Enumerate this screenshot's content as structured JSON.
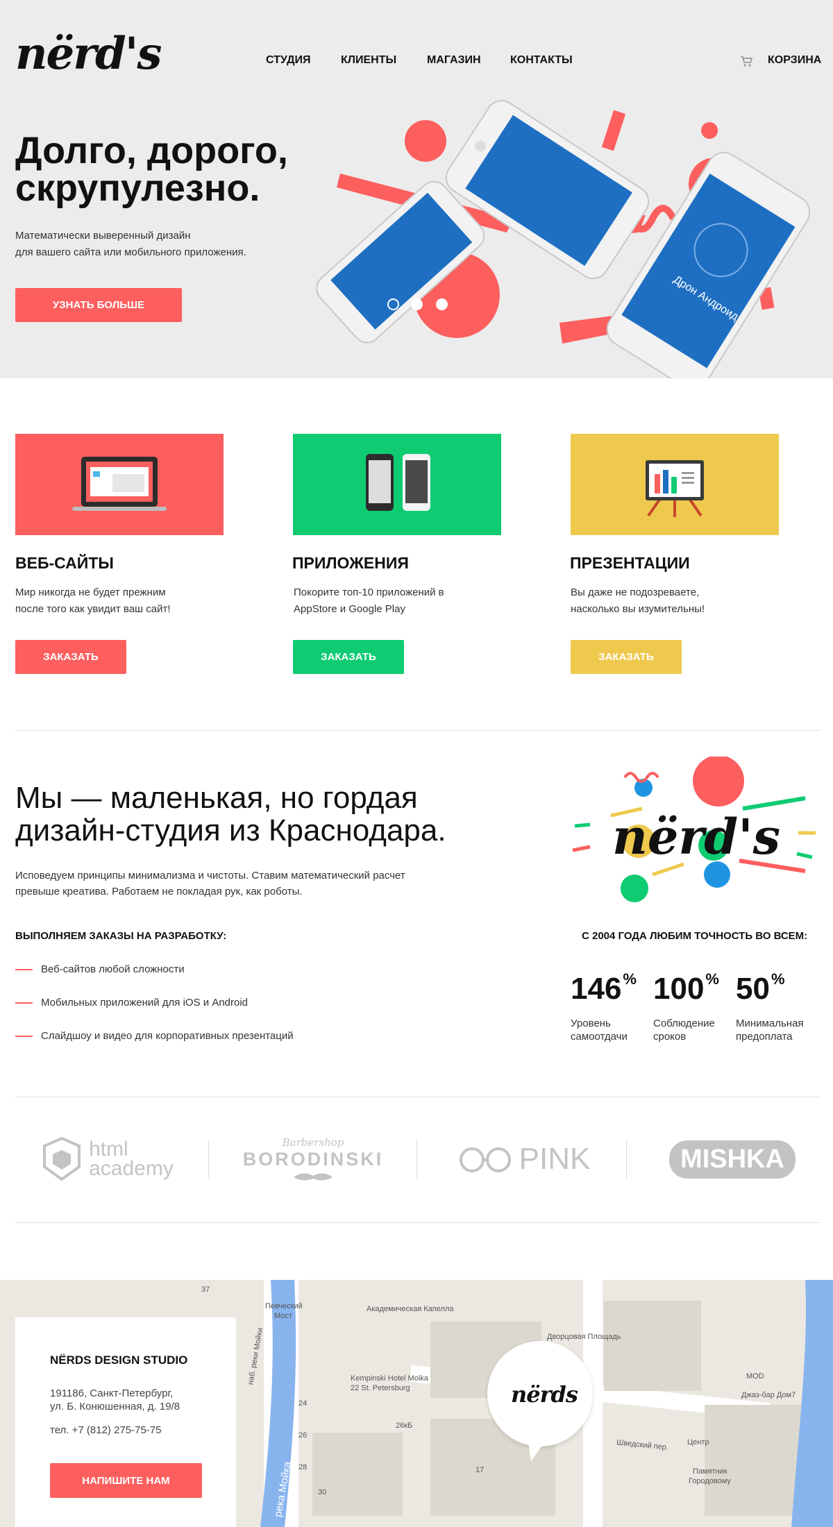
{
  "header": {
    "logo": "nërd's",
    "nav": [
      "СТУДИЯ",
      "КЛИЕНТЫ",
      "МАГАЗИН",
      "КОНТАКТЫ"
    ],
    "cart_label": "КОРЗИНА",
    "cart_icon": "cart-icon"
  },
  "hero": {
    "title_line1": "Долго, дорого,",
    "title_line2": "скрупулезно.",
    "text_line1": "Математически выверенный дизайн",
    "text_line2": "для вашего сайта или мобильного приложения.",
    "button": "УЗНАТЬ БОЛЬШЕ",
    "slides_total": 3,
    "slide_active": 1,
    "phone_app_title": "Дрон Андроид"
  },
  "services": [
    {
      "title": "ВЕБ-САЙТЫ",
      "text_line1": "Мир никогда не будет прежним",
      "text_line2": "после того как увидит ваш сайт!",
      "button": "ЗАКАЗАТЬ",
      "color": "#fd5e5e",
      "icon": "laptop-icon"
    },
    {
      "title": "ПРИЛОЖЕНИЯ",
      "text_line1": "Покорите топ-10 приложений в",
      "text_line2": "AppStore и Google Play",
      "button": "ЗАКАЗАТЬ",
      "color": "#0fcb72",
      "icon": "phones-icon"
    },
    {
      "title": "ПРЕЗЕНТАЦИИ",
      "text_line1": "Вы даже не подозреваете,",
      "text_line2": "насколько вы изумительны!",
      "button": "ЗАКАЗАТЬ",
      "color": "#eec94d",
      "icon": "presentation-board-icon"
    }
  ],
  "about": {
    "title_line1": "Мы — маленькая, но гордая",
    "title_line2": "дизайн-студия из Краснодара.",
    "text_line1": "Исповедуем принципы минимализма и чистоты. Ставим математический расчет",
    "text_line2": "превыше креатива. Работаем не покладая рук, как роботы.",
    "list_heading": "ВЫПОЛНЯЕМ ЗАКАЗЫ НА РАЗРАБОТКУ:",
    "list": [
      "Веб-сайтов любой сложности",
      "Мобильных приложений для iOS и Android",
      "Слайдшоу и видео для корпоративных презентаций"
    ],
    "stats_heading": "С 2004 ГОДА ЛЮБИМ ТОЧНОСТЬ ВО ВСЕМ:",
    "stats": [
      {
        "value": "146",
        "unit": "%",
        "label_line1": "Уровень",
        "label_line2": "самоотдачи"
      },
      {
        "value": "100",
        "unit": "%",
        "label_line1": "Соблюдение",
        "label_line2": "сроков"
      },
      {
        "value": "50",
        "unit": "%",
        "label_line1": "Минимальная",
        "label_line2": "предоплата"
      }
    ],
    "logo_art": "nërd's"
  },
  "partners": [
    {
      "name_line1": "html",
      "name_line2": "academy"
    },
    {
      "name_top": "Barbershop",
      "name": "BORODINSKI"
    },
    {
      "name": "PINK"
    },
    {
      "name": "MISHKA"
    }
  ],
  "map": {
    "labels": [
      "Певческий",
      "Мост",
      "Академическая Капелла",
      "Дворцовая Площадь",
      "Kempinski Hotel Moika",
      "22 St. Petersburg",
      "наб. реки Мойки",
      "река Мойка",
      "MOD",
      "Джаз-бар Дом7",
      "Центр",
      "Шведский пер.",
      "Памятник",
      "Городовому",
      "26кБ",
      "24",
      "26",
      "28",
      "30",
      "17",
      "37"
    ],
    "pin_logo": "nërds"
  },
  "contact": {
    "name": "NËRDS DESIGN STUDIO",
    "address_line1": "191186, Санкт-Петербург,",
    "address_line2": "ул. Б. Конюшенная, д. 19/8",
    "phone": "тел. +7 (812) 275-75-75",
    "button": "НАПИШИТЕ НАМ"
  },
  "colors": {
    "red": "#fd5e5e",
    "green": "#0fcb72",
    "yellow": "#eec94d",
    "blue": "#1e6fc2",
    "hero_bg": "#ececec"
  }
}
